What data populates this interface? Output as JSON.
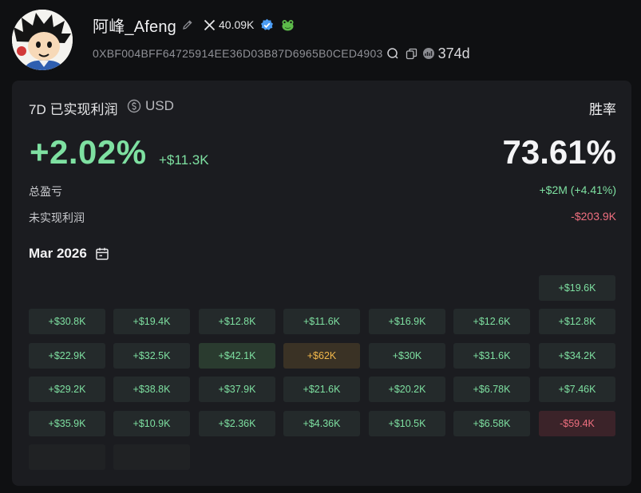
{
  "profile": {
    "name": "阿峰_Afeng",
    "x_followers": "40.09K",
    "address": "0XBF004BFF64725914EE36D03B87D6965B0CED4903",
    "age": "374d"
  },
  "colors": {
    "positive": "#7ee0a1",
    "negative": "#ef6f7f",
    "highlight": "#f2b84b",
    "verified": "#4c9df5",
    "background": "#0f1012",
    "card": "#1b1c20"
  },
  "icons": [
    "edit-icon",
    "x-logo-icon",
    "verified-badge-icon",
    "frog-tag-icon",
    "search-icon",
    "copy-icon",
    "explorer-icon",
    "currency-switch-icon",
    "calendar-icon"
  ],
  "stats": {
    "period_label": "7D 已实现利润",
    "currency": "USD",
    "win_rate_label": "胜率",
    "realized_pct": "+2.02%",
    "realized_usd": "+$11.3K",
    "win_rate": "73.61%",
    "total_pnl_label": "总盈亏",
    "total_pnl": "+$2M (+4.41%)",
    "unrealized_label": "未实现利润",
    "unrealized": "-$203.9K"
  },
  "calendar": {
    "month": "Mar 2026",
    "weeks": [
      [
        "",
        "",
        "",
        "",
        "",
        "",
        "+$19.6K"
      ],
      [
        "+$30.8K",
        "+$19.4K",
        "+$12.8K",
        "+$11.6K",
        "+$16.9K",
        "+$12.6K",
        "+$12.8K"
      ],
      [
        "+$22.9K",
        "+$32.5K",
        "+$42.1K",
        "+$62K",
        "+$30K",
        "+$31.6K",
        "+$34.2K"
      ],
      [
        "+$29.2K",
        "+$38.8K",
        "+$37.9K",
        "+$21.6K",
        "+$20.2K",
        "+$6.78K",
        "+$7.46K"
      ],
      [
        "+$35.9K",
        "+$10.9K",
        "+$2.36K",
        "+$4.36K",
        "+$10.5K",
        "+$6.58K",
        "-$59.4K"
      ],
      [
        "",
        ""
      ]
    ]
  }
}
